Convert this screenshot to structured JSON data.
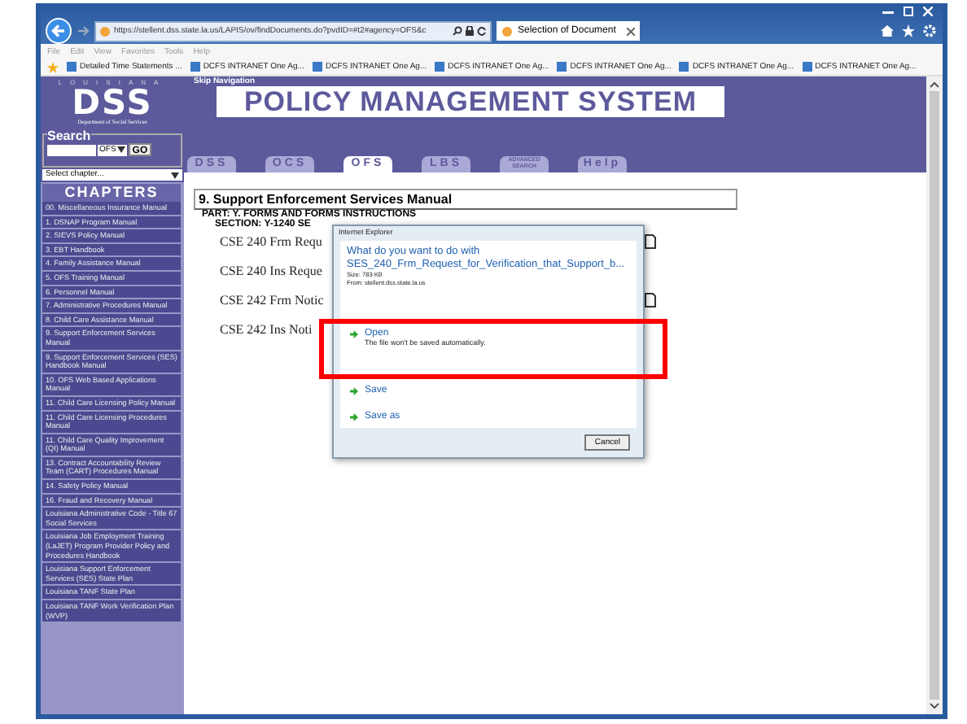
{
  "browser": {
    "address": "https://stellent.dss.state.la.us/LAPIS/ov/findDocuments.do?pvdID=#t2#agency=OFS&c",
    "tab": "Selection of Document",
    "menu": [
      "File",
      "Edit",
      "View",
      "Favorites",
      "Tools",
      "Help"
    ],
    "favorites": [
      "Detailed Time Statements ...",
      "DCFS INTRANET One Ag...",
      "DCFS INTRANET One Ag...",
      "DCFS INTRANET One Ag...",
      "DCFS INTRANET One Ag...",
      "DCFS INTRANET One Ag...",
      "DCFS INTRANET One Ag..."
    ]
  },
  "header": {
    "state_label": "LOUISIANA",
    "logo": "DSS",
    "department": "Department of Social Services",
    "skip_link": "Skip Navigation",
    "title": "POLICY MANAGEMENT SYSTEM"
  },
  "search": {
    "label": "Search",
    "agency": "OFS",
    "button": "GO",
    "chapter_select": "Select chapter..."
  },
  "tabs": [
    {
      "label": "DSS",
      "selected": false
    },
    {
      "label": "OCS",
      "selected": false
    },
    {
      "label": "OFS",
      "selected": true
    },
    {
      "label": "LBS",
      "selected": false
    },
    {
      "label": "ADVANCED SEARCH",
      "selected": false
    },
    {
      "label": "Help",
      "selected": false
    }
  ],
  "chapters": {
    "title": "CHAPTERS",
    "items": [
      "00. Miscellaneous Insurance Manual",
      "1. DSNAP Program Manual",
      "2. SIEVS Policy Manual",
      "3. EBT Handbook",
      "4. Family Assistance Manual",
      "5. OFS Training Manual",
      "6. Personnel Manual",
      "7. Administrative Procedures Manual",
      "8. Child Care Assistance Manual",
      "9. Support Enforcement Services Manual",
      "9. Support Enforcement Services (SES) Handbook Manual",
      "10. OFS Web Based Applications Manual",
      "11. Child Care Licensing Policy Manual",
      "11. Child Care Licensing Procedures Manual",
      "11. Child Care Quality Improvement (QI) Manual",
      "13. Contract Accountability Review Team (CART) Procedures Manual",
      "14. Safety Policy Manual",
      "16. Fraud and Recovery Manual",
      "Louisiana Administrative Code - Title 67 Social Services",
      "Louisiana Job Employment Training (LaJET) Program Provider Policy and Procedures Handbook",
      "Louisiana Support Enforcement Services (SES) State Plan",
      "Louisiana TANF State Plan",
      "Louisiana TANF Work Verification Plan (WVP)"
    ]
  },
  "content": {
    "manual": "9. Support Enforcement Services Manual",
    "part": "PART: Y. FORMS AND FORMS INSTRUCTIONS",
    "section": "SECTION: Y-1240 SE",
    "documents": [
      "CSE 240 Frm Requ",
      "CSE 240 Ins Reque",
      "CSE 242 Frm Notic",
      "CSE 242 Ins Noti"
    ]
  },
  "dialog": {
    "title": "Internet Explorer",
    "question": "What do you want to do with",
    "file": "SES_240_Frm_Request_for_Verification_that_Support_b...",
    "size": "Size: 783 KB",
    "from": "From: stellent.dss.state.la.us",
    "options": [
      {
        "label": "Open",
        "description": "The file won't be saved automatically."
      },
      {
        "label": "Save"
      },
      {
        "label": "Save as"
      }
    ],
    "cancel": "Cancel"
  }
}
